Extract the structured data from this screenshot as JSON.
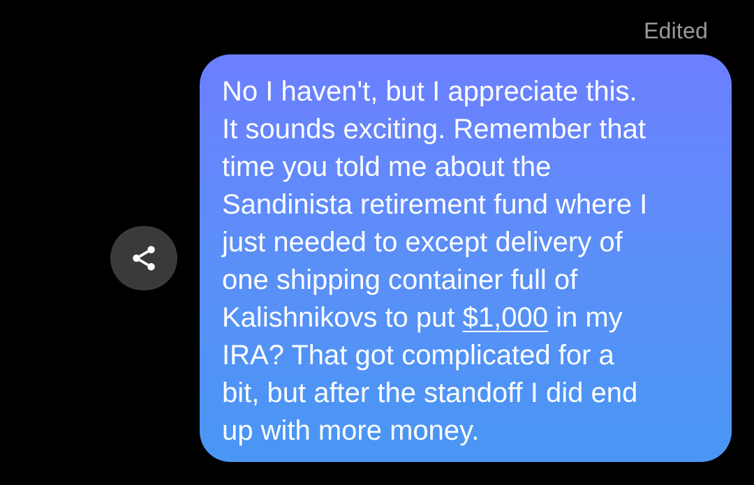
{
  "status": {
    "edited_label": "Edited"
  },
  "actions": {
    "share_icon": "share-icon"
  },
  "message": {
    "lines": [
      "No I haven't, but I appreciate this.",
      "It sounds exciting. Remember that",
      "time you told me about the",
      "Sandinista retirement fund where I",
      "just needed to except delivery of",
      "one shipping container full of"
    ],
    "line7_before": "Kalishnikovs to put ",
    "line7_link": "$1,000",
    "line7_after": " in my",
    "lines_end": [
      "IRA?  That got complicated for a",
      "bit, but after the standoff I did end",
      "up with more money."
    ],
    "bubble_gradient": [
      "#6c7fff",
      "#4996f4"
    ]
  },
  "colors": {
    "background": "#000000",
    "edited_text": "#9a9a9a",
    "share_button_bg": "#3a3a3c",
    "message_text": "#ffffff"
  }
}
